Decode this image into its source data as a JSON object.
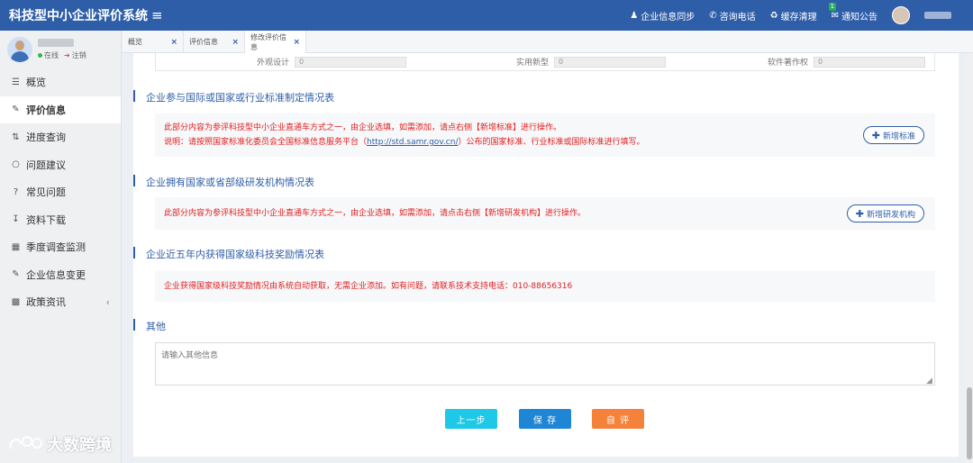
{
  "header": {
    "title": "科技型中小企业评价系统",
    "links": [
      {
        "icon": "user-icon",
        "label": "企业信息同步"
      },
      {
        "icon": "phone-icon",
        "label": "咨询电话"
      },
      {
        "icon": "refresh-icon",
        "label": "缓存清理"
      },
      {
        "icon": "mail-icon",
        "label": "通知公告",
        "badge": "1"
      }
    ]
  },
  "sidebar": {
    "status_online": "在线",
    "status_logout": "注销",
    "items": [
      {
        "label": "概览",
        "icon": "layers-icon"
      },
      {
        "label": "评价信息",
        "icon": "edit-icon",
        "active": true
      },
      {
        "label": "进度查询",
        "icon": "sort-icon"
      },
      {
        "label": "问题建议",
        "icon": "comment-icon"
      },
      {
        "label": "常见问题",
        "icon": "question-icon"
      },
      {
        "label": "资料下载",
        "icon": "download-icon"
      },
      {
        "label": "季度调查监测",
        "icon": "grid-icon"
      },
      {
        "label": "企业信息变更",
        "icon": "edit-icon"
      },
      {
        "label": "政策资讯",
        "icon": "list-icon"
      }
    ]
  },
  "tabs": [
    {
      "label": "概览"
    },
    {
      "label": "评价信息"
    },
    {
      "label": "修改评价信息",
      "active": true
    }
  ],
  "prev_row": [
    {
      "label": "外观设计",
      "value": "0"
    },
    {
      "label": "实用新型",
      "value": "0"
    },
    {
      "label": "软件著作权",
      "value": "0"
    }
  ],
  "sections": {
    "standards": {
      "title": "企业参与国际或国家或行业标准制定情况表",
      "line1": "此部分内容为参评科技型中小企业直通车方式之一，由企业选填，如需添加，请点右侧【新增标准】进行操作。",
      "line2_prefix": "说明：请按照国家标准化委员会全国标准信息服务平台（",
      "line2_link": "http://std.samr.gov.cn/",
      "line2_suffix": "）公布的国家标准、行业标准或国际标准进行填写。",
      "button": "新增标准"
    },
    "rnd": {
      "title": "企业拥有国家或省部级研发机构情况表",
      "line1": "此部分内容为参评科技型中小企业直通车方式之一，由企业选填，如需添加，请点击右侧【新增研发机构】进行操作。",
      "button": "新增研发机构"
    },
    "awards": {
      "title": "企业近五年内获得国家级科技奖励情况表",
      "line1": "企业获得国家级科技奖励情况由系统自动获取，无需企业添加。如有问题，请联系技术支持电话：010-88656316"
    },
    "other": {
      "title": "其他",
      "placeholder": "请输入其他信息"
    }
  },
  "buttons": {
    "prev": "上一步",
    "save": "保 存",
    "evaluate": "自 评"
  },
  "watermark": "大数跨境"
}
